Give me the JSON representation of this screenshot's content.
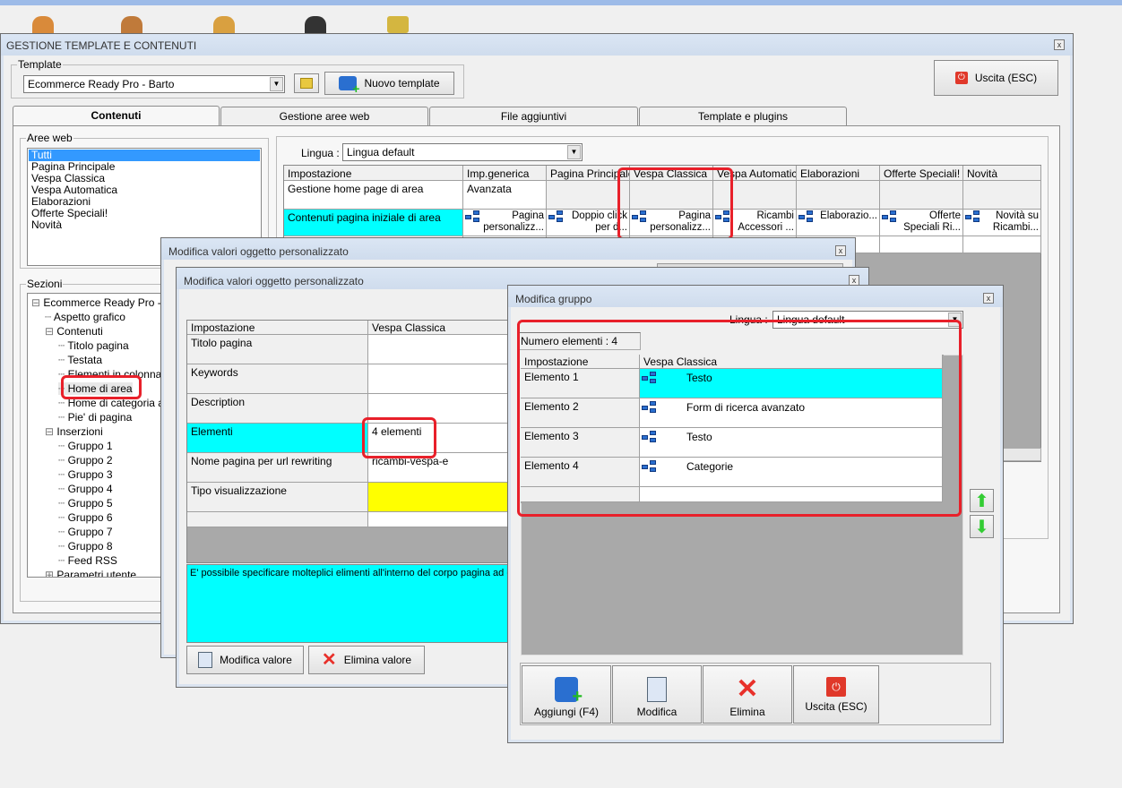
{
  "main": {
    "title": "GESTIONE TEMPLATE E CONTENUTI",
    "template_group_label": "Template",
    "template_value": "Ecommerce Ready Pro - Barto",
    "new_template_label": "Nuovo template",
    "exit_label": "Uscita (ESC)",
    "tabs": [
      "Contenuti",
      "Gestione aree web",
      "File aggiuntivi",
      "Template e plugins"
    ],
    "aree_web_label": "Aree web",
    "aree_web": [
      "Tutti",
      "Pagina Principale",
      "Vespa Classica",
      "Vespa Automatica",
      "Elaborazioni",
      "Offerte Speciali!",
      "Novità"
    ],
    "sezioni_label": "Sezioni",
    "tree": [
      "Ecommerce Ready Pro - Ba",
      "Aspetto grafico",
      "Contenuti",
      "Titolo pagina",
      "Testata",
      "Elementi in colonna",
      "Home di area",
      "Home di categoria art",
      "Pie' di pagina",
      "Inserzioni",
      "Gruppo 1",
      "Gruppo 2",
      "Gruppo 3",
      "Gruppo 4",
      "Gruppo 5",
      "Gruppo 6",
      "Gruppo 7",
      "Gruppo 8",
      "Feed RSS",
      "Parametri utente"
    ],
    "lingua_label": "Lingua :",
    "lingua_value": "Lingua default",
    "grid_headers": [
      "Impostazione",
      "Imp.generica",
      "Pagina Principale",
      "Vespa Classica",
      "Vespa Automatica",
      "Elaborazioni",
      "Offerte Speciali!",
      "Novità"
    ],
    "grid_row1": [
      "Gestione home page di area",
      "Avanzata",
      "",
      "",
      "",
      "",
      "",
      ""
    ],
    "grid_row2": [
      "Contenuti pagina iniziale di area",
      "Pagina personalizz...",
      "Doppio click per d...",
      "Pagina personalizz...",
      "Ricambi Accessori ...",
      "Elaborazio...",
      "Offerte Speciali Ri...",
      "Novità su Ricambi..."
    ]
  },
  "dialog1": {
    "title": "Modifica valori oggetto personalizzato"
  },
  "dialog2": {
    "title": "Modifica valori oggetto personalizzato",
    "headers": [
      "Impostazione",
      "Vespa Classica"
    ],
    "rows": [
      {
        "label": "Titolo pagina",
        "value": ""
      },
      {
        "label": "Keywords",
        "value": ""
      },
      {
        "label": "Description",
        "value": ""
      },
      {
        "label": "Elementi",
        "value": "4 elementi"
      },
      {
        "label": "Nome pagina per url rewriting",
        "value": "ricambi-vespa-e"
      },
      {
        "label": "Tipo visualizzazione",
        "value": ""
      }
    ],
    "info": "E' possibile specificare molteplici elimenti all'interno del corpo pagina ad es",
    "edit_label": "Modifica valore",
    "delete_label": "Elimina valore"
  },
  "dialog3": {
    "title": "Modifica gruppo",
    "lingua_label": "Lingua :",
    "lingua_value": "Lingua default",
    "count_label": "Numero elementi : 4",
    "headers": [
      "Impostazione",
      "Vespa Classica"
    ],
    "rows": [
      {
        "label": "Elemento 1",
        "value": "Testo"
      },
      {
        "label": "Elemento 2",
        "value": "Form di ricerca avanzato"
      },
      {
        "label": "Elemento 3",
        "value": "Testo"
      },
      {
        "label": "Elemento 4",
        "value": "Categorie"
      }
    ],
    "buttons": [
      "Aggiungi (F4)",
      "Modifica",
      "Elimina",
      "Uscita (ESC)"
    ]
  },
  "colors": {
    "highlight": "#00ffff",
    "annotation": "#e8202a",
    "selection": "#3399ff"
  }
}
